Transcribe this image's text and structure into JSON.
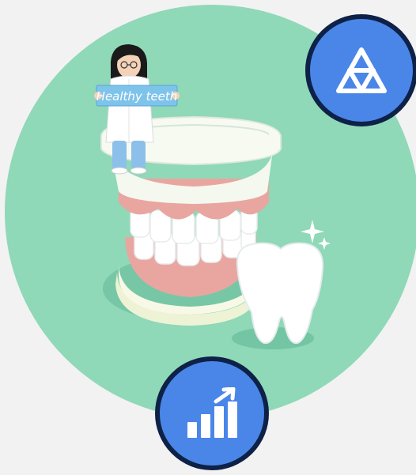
{
  "illustration": {
    "sign_text": "Healthy teeth",
    "colors": {
      "circle": "#8fd8b8",
      "background": "#f2f2f2",
      "badge_fill": "#4a86e8",
      "badge_border": "#0e2147",
      "gum": "#e9a6a0",
      "tooth": "#ffffff",
      "sign": "#7ec3ea"
    }
  },
  "badges": {
    "top": {
      "icon": "triangle-tri-force-icon"
    },
    "bottom": {
      "icon": "growth-chart-icon"
    }
  }
}
